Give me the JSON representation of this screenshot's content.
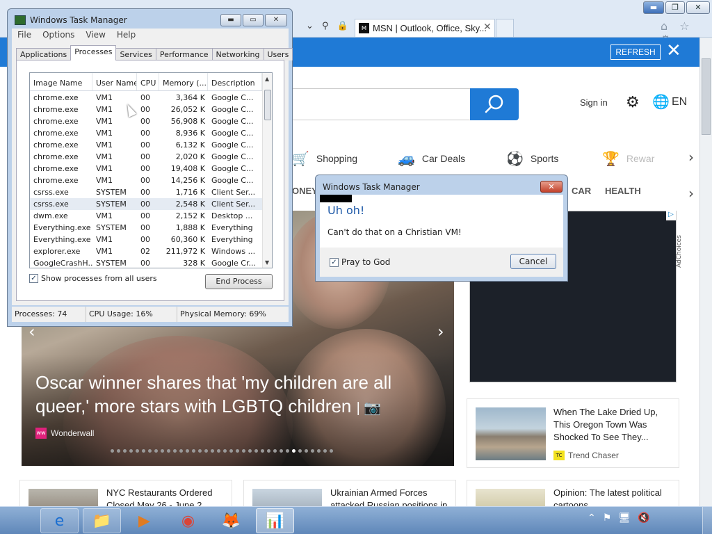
{
  "browser": {
    "tab_title": "MSN | Outlook, Office, Sky...",
    "tab_close": "✕",
    "tab_favicon": "ᴍ",
    "address_icons": "⌄ ⚲ 🔒 ↻",
    "window_controls": {
      "minimize": "▬",
      "maximize": "❐",
      "close": "✕"
    },
    "tools_icons": "⌂ ☆ ⚙"
  },
  "msn": {
    "banner": {
      "refresh_label": "REFRESH",
      "close_label": "✕"
    },
    "sign_in": "Sign in",
    "language": "EN",
    "categories": [
      {
        "label": "Shopping",
        "icon": "cart-icon",
        "glyph": "🛒"
      },
      {
        "label": "Car Deals",
        "icon": "car-icon",
        "glyph": "🚙"
      },
      {
        "label": "Sports",
        "icon": "soccer-ball-icon",
        "glyph": "⚽"
      },
      {
        "label": "Rewar",
        "icon": "trophy-icon",
        "glyph": "🏆"
      }
    ],
    "subnav": [
      "ONEY",
      "CAR",
      "HEALTH"
    ],
    "hero": {
      "title": "Oscar winner shares that 'my children are all queer,' more stars with LGBTQ children",
      "source": "Wonderwall",
      "source_logo": "ww",
      "dot_count": 36,
      "active_dot_index": 29
    },
    "card_lake": {
      "title": "When The Lake Dried Up, This Oregon Town Was Shocked To See They...",
      "source": "Trend Chaser",
      "source_logo": "TC"
    },
    "bottom_cards": [
      "NYC Restaurants Ordered Closed May 26 - June 2",
      "Ukrainian Armed Forces attacked Russian positions in",
      "Opinion: The latest political cartoons"
    ],
    "adchoices": "AdChoices"
  },
  "taskmgr": {
    "title": "Windows Task Manager",
    "window_controls": {
      "minimize": "▬",
      "maximize": "▭",
      "close": "✕"
    },
    "menu": [
      "File",
      "Options",
      "View",
      "Help"
    ],
    "tabs": [
      "Applications",
      "Processes",
      "Services",
      "Performance",
      "Networking",
      "Users"
    ],
    "active_tab": "Processes",
    "columns": [
      "Image Name",
      "User Name",
      "CPU",
      "Memory (...",
      "Description"
    ],
    "rows": [
      [
        "chrome.exe",
        "VM1",
        "00",
        "3,364 K",
        "Google C..."
      ],
      [
        "chrome.exe",
        "VM1",
        "00",
        "26,052 K",
        "Google C..."
      ],
      [
        "chrome.exe",
        "VM1",
        "00",
        "56,908 K",
        "Google C..."
      ],
      [
        "chrome.exe",
        "VM1",
        "00",
        "8,936 K",
        "Google C..."
      ],
      [
        "chrome.exe",
        "VM1",
        "00",
        "6,132 K",
        "Google C..."
      ],
      [
        "chrome.exe",
        "VM1",
        "00",
        "2,020 K",
        "Google C..."
      ],
      [
        "chrome.exe",
        "VM1",
        "00",
        "19,408 K",
        "Google C..."
      ],
      [
        "chrome.exe",
        "VM1",
        "00",
        "14,256 K",
        "Google C..."
      ],
      [
        "csrss.exe",
        "SYSTEM",
        "00",
        "1,716 K",
        "Client Ser..."
      ],
      [
        "csrss.exe",
        "SYSTEM",
        "00",
        "2,548 K",
        "Client Ser..."
      ],
      [
        "dwm.exe",
        "VM1",
        "00",
        "2,152 K",
        "Desktop ..."
      ],
      [
        "Everything.exe",
        "SYSTEM",
        "00",
        "1,888 K",
        "Everything"
      ],
      [
        "Everything.exe",
        "VM1",
        "00",
        "60,360 K",
        "Everything"
      ],
      [
        "explorer.exe",
        "VM1",
        "02",
        "211,972 K",
        "Windows ..."
      ],
      [
        "GoogleCrashH...",
        "SYSTEM",
        "00",
        "328 K",
        "Google Cr..."
      ]
    ],
    "selected_row": 9,
    "show_all_label": "Show processes from all users",
    "show_all_checked": true,
    "end_process_label": "End Process",
    "status": {
      "processes": "Processes: 74",
      "cpu": "CPU Usage: 16%",
      "memory": "Physical Memory: 69%"
    }
  },
  "dialog": {
    "title": "Windows Task Manager",
    "close_label": "✕",
    "heading": "Uh oh!",
    "message": "Can't do that on a Christian VM!",
    "checkbox_label": "Pray to God",
    "checkbox_checked": true,
    "cancel_label": "Cancel"
  },
  "taskbar": {
    "apps": [
      {
        "name": "internet-explorer-icon",
        "glyph": "e",
        "state": "open"
      },
      {
        "name": "file-explorer-icon",
        "glyph": "📁",
        "state": "open"
      },
      {
        "name": "media-player-icon",
        "glyph": "▶",
        "state": "none"
      },
      {
        "name": "chrome-icon",
        "glyph": "◉",
        "state": "none"
      },
      {
        "name": "firefox-icon",
        "glyph": "🦊",
        "state": "none"
      },
      {
        "name": "task-manager-icon",
        "glyph": "📊",
        "state": "active"
      }
    ],
    "tray": [
      "⌃",
      "⚑",
      "🖥",
      "🔇"
    ]
  },
  "colors": {
    "msn_blue": "#1f7ad6",
    "win7_frame": "#bcd1ea",
    "dialog_heading": "#1d58a7"
  }
}
